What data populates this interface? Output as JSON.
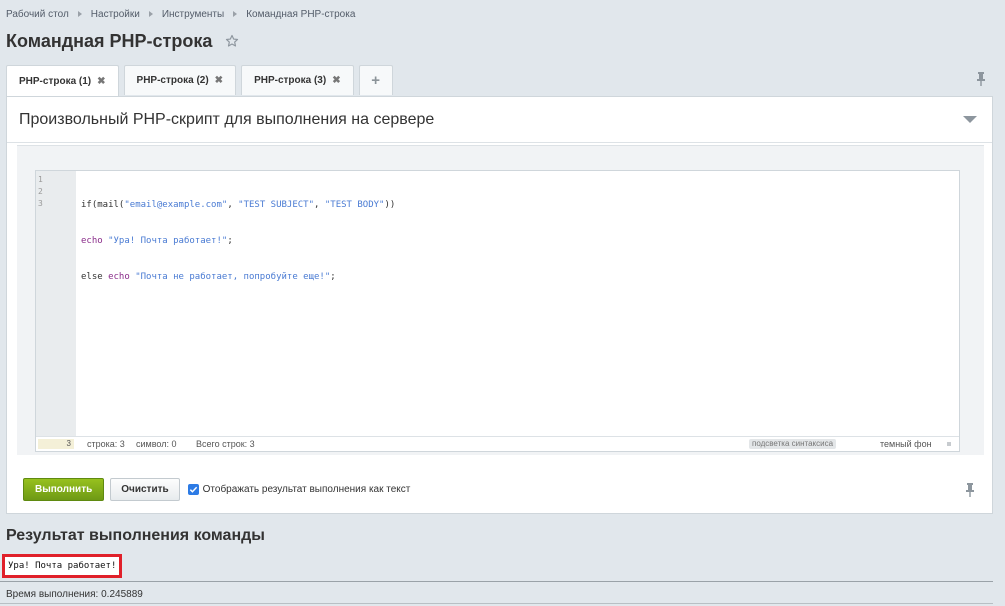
{
  "breadcrumb": [
    "Рабочий стол",
    "Настройки",
    "Инструменты",
    "Командная PHP-строка"
  ],
  "page": {
    "title": "Командная PHP-строка"
  },
  "tabs": [
    {
      "label": "PHP-строка (1)",
      "active": true
    },
    {
      "label": "PHP-строка (2)",
      "active": false
    },
    {
      "label": "PHP-строка (3)",
      "active": false
    }
  ],
  "tabs_add_label": "+",
  "panel": {
    "title": "Произвольный PHP-скрипт для выполнения на сервере"
  },
  "editor": {
    "line_numbers": [
      "1",
      "2",
      "3"
    ],
    "code": {
      "line1": {
        "p1": "if(mail(",
        "s1": "\"email@example.com\"",
        "p2": ", ",
        "s2": "\"TEST SUBJECT\"",
        "p3": ", ",
        "s3": "\"TEST BODY\"",
        "p4": "))"
      },
      "line2": {
        "k1": "echo ",
        "s1": "\"Ура! Почта работает!\"",
        "p1": ";"
      },
      "line3": {
        "p1": "else ",
        "k1": "echo ",
        "s1": "\"Почта не работает, попробуйте еще!\"",
        "p2": ";"
      }
    },
    "status": {
      "current_line": "3",
      "row": "строка: 3",
      "symbol": "символ: 0",
      "total": "Всего строк: 3",
      "highlight_label": "подсветка синтаксиса",
      "dark_label": "темный фон"
    }
  },
  "actions": {
    "run_label": "Выполнить",
    "clear_label": "Очистить",
    "checkbox_label": "Отображать результат выполнения как текст",
    "checkbox_checked": true
  },
  "result": {
    "title": "Результат выполнения команды",
    "output": "Ура! Почта работает!",
    "exec_time": "Время выполнения: 0.245889"
  },
  "colors": {
    "run_button": "#80a81c",
    "highlight_border": "#e0202a",
    "checkbox": "#2d7be5",
    "string": "#4a7bd3",
    "keyword": "#8a2d8a"
  }
}
